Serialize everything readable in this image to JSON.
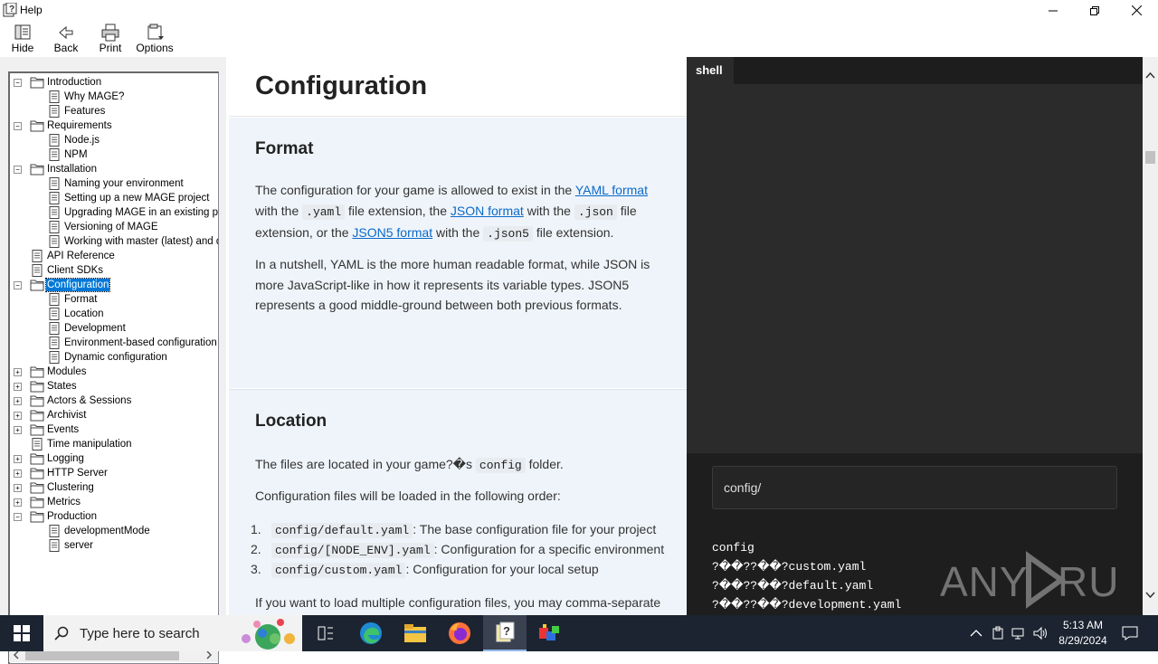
{
  "window": {
    "title": "Help",
    "toolbar": [
      {
        "label": "Hide",
        "icon": "hide-icon"
      },
      {
        "label": "Back",
        "icon": "back-arrow-icon"
      },
      {
        "label": "Print",
        "icon": "printer-icon"
      },
      {
        "label": "Options",
        "icon": "options-icon"
      }
    ]
  },
  "tree": {
    "items": [
      {
        "label": "Introduction",
        "level": 0,
        "type": "folder",
        "expanded": true
      },
      {
        "label": "Why MAGE?",
        "level": 1,
        "type": "page"
      },
      {
        "label": "Features",
        "level": 1,
        "type": "page"
      },
      {
        "label": "Requirements",
        "level": 0,
        "type": "folder",
        "expanded": true
      },
      {
        "label": "Node.js",
        "level": 1,
        "type": "page"
      },
      {
        "label": "NPM",
        "level": 1,
        "type": "page"
      },
      {
        "label": "Installation",
        "level": 0,
        "type": "folder",
        "expanded": true
      },
      {
        "label": "Naming your environment",
        "level": 1,
        "type": "page"
      },
      {
        "label": "Setting up a new MAGE project",
        "level": 1,
        "type": "page"
      },
      {
        "label": "Upgrading MAGE in an existing project",
        "level": 1,
        "type": "page"
      },
      {
        "label": "Versioning of MAGE",
        "level": 1,
        "type": "page"
      },
      {
        "label": "Working with master (latest) and development",
        "level": 1,
        "type": "page"
      },
      {
        "label": "API Reference",
        "level": 0,
        "type": "page"
      },
      {
        "label": "Client SDKs",
        "level": 0,
        "type": "page"
      },
      {
        "label": "Configuration",
        "level": 0,
        "type": "folder",
        "expanded": true,
        "selected": true
      },
      {
        "label": "Format",
        "level": 1,
        "type": "page"
      },
      {
        "label": "Location",
        "level": 1,
        "type": "page"
      },
      {
        "label": "Development",
        "level": 1,
        "type": "page"
      },
      {
        "label": "Environment-based configuration",
        "level": 1,
        "type": "page"
      },
      {
        "label": "Dynamic configuration",
        "level": 1,
        "type": "page"
      },
      {
        "label": "Modules",
        "level": 0,
        "type": "folder",
        "expanded": false
      },
      {
        "label": "States",
        "level": 0,
        "type": "folder",
        "expanded": false
      },
      {
        "label": "Actors & Sessions",
        "level": 0,
        "type": "folder",
        "expanded": false
      },
      {
        "label": "Archivist",
        "level": 0,
        "type": "folder",
        "expanded": false
      },
      {
        "label": "Events",
        "level": 0,
        "type": "folder",
        "expanded": false
      },
      {
        "label": "Time manipulation",
        "level": 0,
        "type": "page"
      },
      {
        "label": "Logging",
        "level": 0,
        "type": "folder",
        "expanded": false
      },
      {
        "label": "HTTP Server",
        "level": 0,
        "type": "folder",
        "expanded": false
      },
      {
        "label": "Clustering",
        "level": 0,
        "type": "folder",
        "expanded": false
      },
      {
        "label": "Metrics",
        "level": 0,
        "type": "folder",
        "expanded": false
      },
      {
        "label": "Production",
        "level": 0,
        "type": "folder",
        "expanded": true
      },
      {
        "label": "developmentMode",
        "level": 1,
        "type": "page"
      },
      {
        "label": "server",
        "level": 1,
        "type": "page"
      }
    ]
  },
  "doc": {
    "title": "Configuration",
    "format": {
      "heading": "Format",
      "p1": {
        "t1": "The configuration for your game is allowed to exist in the ",
        "link1": "YAML format",
        "t2": " with the ",
        "code1": ".yaml",
        "t3": " file extension, the ",
        "link2": "JSON format",
        "t4": " with the ",
        "code2": ".json",
        "t5": " file extension, or the ",
        "link3": "JSON5 format",
        "t6": " with the ",
        "code3": ".json5",
        "t7": " file extension."
      },
      "p2": "In a nutshell, YAML is the more human readable format, while JSON is more JavaScript-like in how it represents its variable types. JSON5 represents a good middle-ground between both previous formats."
    },
    "location": {
      "heading": "Location",
      "p1": {
        "t1": "The files are located in your game?�s ",
        "code": "config",
        "t2": " folder."
      },
      "p2": "Configuration files will be loaded in the following order:",
      "list": [
        {
          "num": "1.",
          "code": "config/default.yaml",
          "text": ": The base configuration file for your project"
        },
        {
          "num": "2.",
          "code": "config/[NODE_ENV].yaml",
          "text": ": Configuration for a specific environment"
        },
        {
          "num": "3.",
          "code": "config/custom.yaml",
          "text": ": Configuration for your local setup"
        }
      ],
      "p3": "If you want to load multiple configuration files, you may comma-separate"
    }
  },
  "shell": {
    "tab": "shell",
    "input": "config/",
    "output": [
      "config",
      "?��??��?custom.yaml",
      "?��??��?default.yaml",
      "?��??��?development.yaml"
    ]
  },
  "watermark": "ANY RUN",
  "taskbar": {
    "search_placeholder": "Type here to search",
    "time": "5:13 AM",
    "date": "8/29/2024"
  }
}
